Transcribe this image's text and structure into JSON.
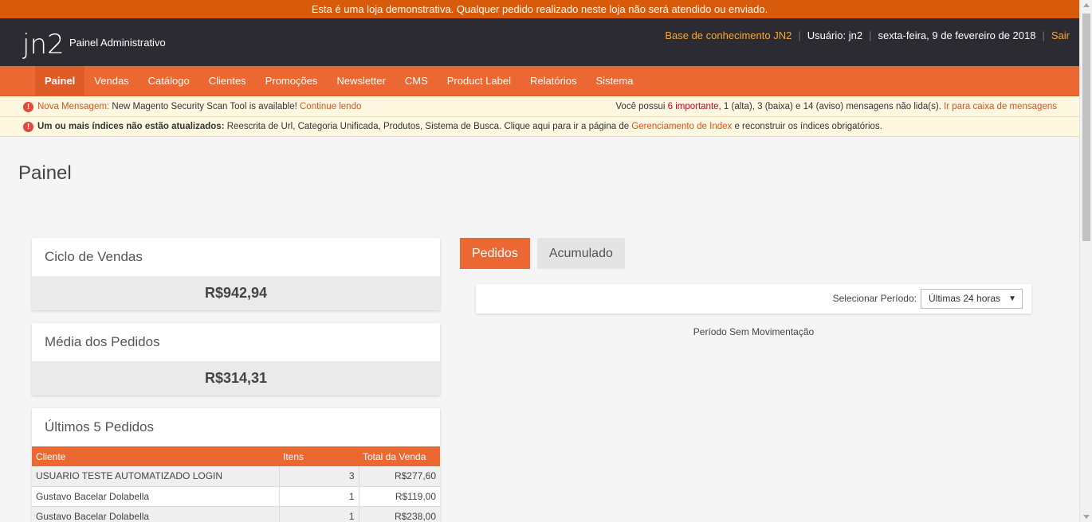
{
  "demo_notice": "Esta é uma loja demonstrativa. Qualquer pedido realizado neste loja não será atendido ou enviado.",
  "header": {
    "logo_text": "jn2",
    "subtitle": "Painel Administrativo",
    "knowledge_base": "Base de conhecimento JN2",
    "user": "Usuário: jn2",
    "date": "sexta-feira, 9 de fevereiro de 2018",
    "logout": "Sair"
  },
  "nav": {
    "items": [
      "Painel",
      "Vendas",
      "Catálogo",
      "Clientes",
      "Promoções",
      "Newsletter",
      "CMS",
      "Product Label",
      "Relatórios",
      "Sistema"
    ],
    "active": "Painel"
  },
  "messages": {
    "new_label": "Nova Mensagem:",
    "new_text": "New Magento Security Scan Tool is available!",
    "continue": "Continue lendo",
    "summary_prefix": "Você possui",
    "important": "6 importante",
    "summary_rest": ", 1 (alta), 3 (baixa) e 14 (aviso) mensagens não lida(s).",
    "inbox_link": "Ir para caixa de mensagens",
    "index_label": "Um ou mais índices não estão atualizados:",
    "index_text": "Reescrita de Url, Categoria Unificada, Produtos, Sistema de Busca. Clique aqui para ir a página de",
    "index_link": "Gerenciamento de Index",
    "index_suffix": "e reconstruir os índices obrigatórios."
  },
  "page": {
    "title": "Painel"
  },
  "sales_cycle": {
    "title": "Ciclo de Vendas",
    "value": "R$942,94"
  },
  "avg_orders": {
    "title": "Média dos Pedidos",
    "value": "R$314,31"
  },
  "last_orders": {
    "title": "Últimos 5 Pedidos",
    "columns": [
      "Cliente",
      "Itens",
      "Total da Venda"
    ],
    "rows": [
      {
        "customer": "USUARIO TESTE AUTOMATIZADO LOGIN",
        "items": "3",
        "total": "R$277,60"
      },
      {
        "customer": "Gustavo Bacelar Dolabella",
        "items": "1",
        "total": "R$119,00"
      },
      {
        "customer": "Gustavo Bacelar Dolabella",
        "items": "1",
        "total": "R$238,00"
      }
    ]
  },
  "tabs": {
    "orders": "Pedidos",
    "accumulated": "Acumulado"
  },
  "period": {
    "label": "Selecionar Período:",
    "selected": "Últimas 24 horas",
    "empty": "Período Sem Movimentação"
  },
  "colors": {
    "accent": "#eb6833",
    "header": "#2b2b31",
    "demo_bar": "#d85a0b"
  }
}
